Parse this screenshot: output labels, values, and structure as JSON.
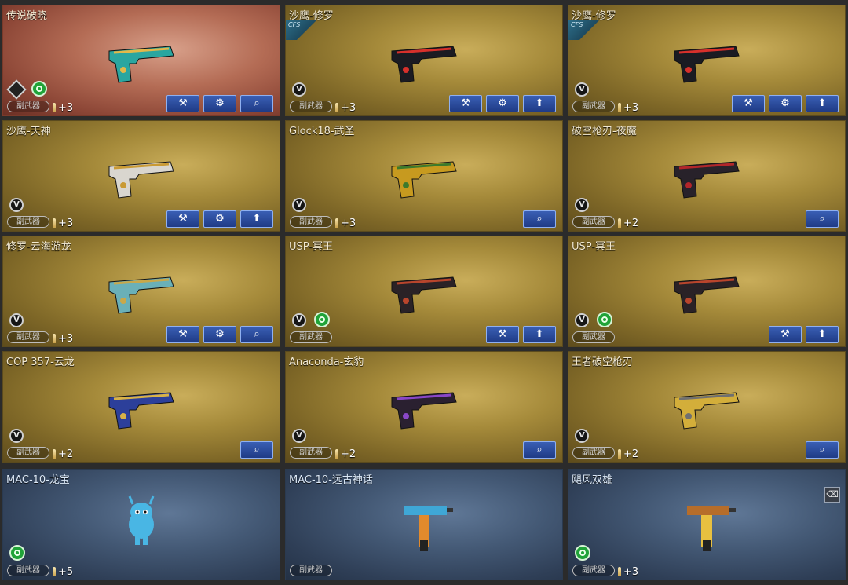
{
  "colors": {
    "gold_card": "#a58a3a",
    "legend_card": "#b46c55",
    "blue_card": "#435874",
    "button_blue": "#2a4aa0",
    "rarity_green": "#20a338"
  },
  "cards": [
    {
      "title": "传说破晓",
      "style": "legend",
      "tag": "副武器",
      "plus": "+3",
      "badges": [
        "diamond",
        "green"
      ],
      "buttons": [
        "repair",
        "settings",
        "search"
      ],
      "weapon_color": "#2aa6a0",
      "trim": "#e2b84a"
    },
    {
      "title": "沙鹰-修罗",
      "style": "gold",
      "cfs": "CFS",
      "tag": "副武器",
      "plus": "+3",
      "badges": [
        "v"
      ],
      "buttons": [
        "repair",
        "settings",
        "upgrade"
      ],
      "weapon_color": "#1b1b22",
      "trim": "#d8302b"
    },
    {
      "title": "沙鹰-修罗",
      "style": "gold",
      "cfs": "CFS",
      "tag": "副武器",
      "plus": "+3",
      "badges": [
        "v"
      ],
      "buttons": [
        "repair",
        "settings",
        "upgrade"
      ],
      "weapon_color": "#1b1b22",
      "trim": "#d8302b"
    },
    {
      "title": "沙鹰-天神",
      "style": "gold",
      "tag": "副武器",
      "plus": "+3",
      "badges": [
        "v"
      ],
      "buttons": [
        "repair",
        "settings",
        "upgrade"
      ],
      "weapon_color": "#d9d6cf",
      "trim": "#c99a35"
    },
    {
      "title": "Glock18-武圣",
      "style": "gold",
      "tag": "副武器",
      "plus": "+3",
      "badges": [
        "v"
      ],
      "buttons": [
        "search"
      ],
      "weapon_color": "#c79a1f",
      "trim": "#3c7a2c"
    },
    {
      "title": "破空枪刃-夜魔",
      "style": "gold",
      "tag": "副武器",
      "plus": "+2",
      "badges": [
        "v"
      ],
      "buttons": [
        "search"
      ],
      "weapon_color": "#28222a",
      "trim": "#b3262a"
    },
    {
      "title": "修罗-云海游龙",
      "style": "gold",
      "tag": "副武器",
      "plus": "+3",
      "badges": [
        "v"
      ],
      "buttons": [
        "repair",
        "settings",
        "search"
      ],
      "weapon_color": "#6ab0b8",
      "trim": "#c9a84a"
    },
    {
      "title": "USP-冥王",
      "style": "gold",
      "tag": "副武器",
      "plus": "",
      "badges": [
        "v",
        "green"
      ],
      "buttons": [
        "repair",
        "upgrade"
      ],
      "weapon_color": "#2a2226",
      "trim": "#b9452c"
    },
    {
      "title": "USP-冥王",
      "style": "gold",
      "tag": "副武器",
      "plus": "",
      "badges": [
        "v",
        "green"
      ],
      "buttons": [
        "repair",
        "upgrade"
      ],
      "weapon_color": "#2a2226",
      "trim": "#b9452c"
    },
    {
      "title": "COP 357-云龙",
      "style": "gold",
      "tag": "副武器",
      "plus": "+2",
      "badges": [
        "v"
      ],
      "buttons": [
        "search"
      ],
      "weapon_color": "#2c3f9a",
      "trim": "#d8b248"
    },
    {
      "title": "Anaconda-玄豹",
      "style": "gold",
      "tag": "副武器",
      "plus": "+2",
      "badges": [
        "v"
      ],
      "buttons": [
        "search"
      ],
      "weapon_color": "#2a2030",
      "trim": "#8a47c8"
    },
    {
      "title": "王者破空枪刃",
      "style": "gold",
      "tag": "副武器",
      "plus": "+2",
      "badges": [
        "v"
      ],
      "buttons": [
        "search"
      ],
      "weapon_color": "#d3ae3a",
      "trim": "#707070"
    },
    {
      "title": "MAC-10-龙宝",
      "style": "blue",
      "tag": "副武器",
      "plus": "+5",
      "badges": [
        "green"
      ],
      "buttons": [],
      "weapon_color": "#49b6e4",
      "trim": "#ffffff",
      "pet": true
    },
    {
      "title": "MAC-10-远古神话",
      "style": "blue",
      "tag": "副武器",
      "plus": "",
      "badges": [],
      "buttons": [],
      "weapon_color": "#3fa7d6",
      "trim": "#e28a2c"
    },
    {
      "title": "飓风双雄",
      "style": "blue",
      "tag": "副武器",
      "plus": "+3",
      "badges": [
        "green"
      ],
      "buttons": [],
      "weapon_color": "#b66d2a",
      "trim": "#e8c040",
      "trash": true
    }
  ],
  "icons": {
    "repair": "✎⚙",
    "settings": "⚙",
    "search": "🔍",
    "upgrade": "⬆",
    "trash": "🗑",
    "v": "V"
  }
}
